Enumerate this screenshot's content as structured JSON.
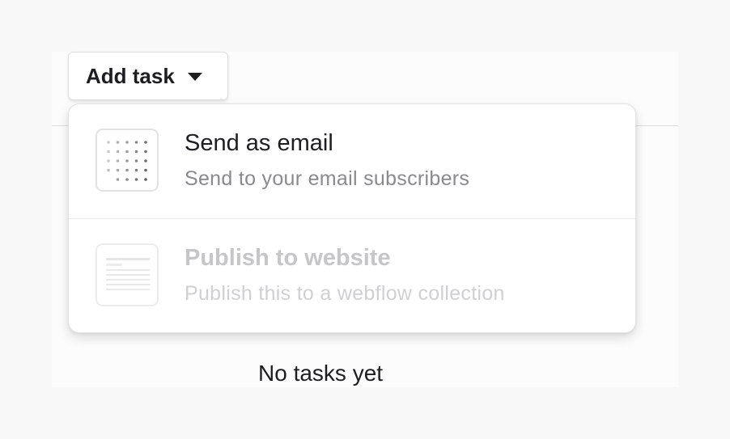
{
  "header": {
    "add_task_label": "Add task"
  },
  "empty_state": {
    "message": "No tasks yet"
  },
  "menu": {
    "items": [
      {
        "title": "Send as email",
        "description": "Send to your email subscribers",
        "icon": "dot-grid-icon",
        "enabled": true
      },
      {
        "title": "Publish to website",
        "description": "Publish this to a webflow collection",
        "icon": "document-lines-icon",
        "enabled": false
      }
    ]
  }
}
